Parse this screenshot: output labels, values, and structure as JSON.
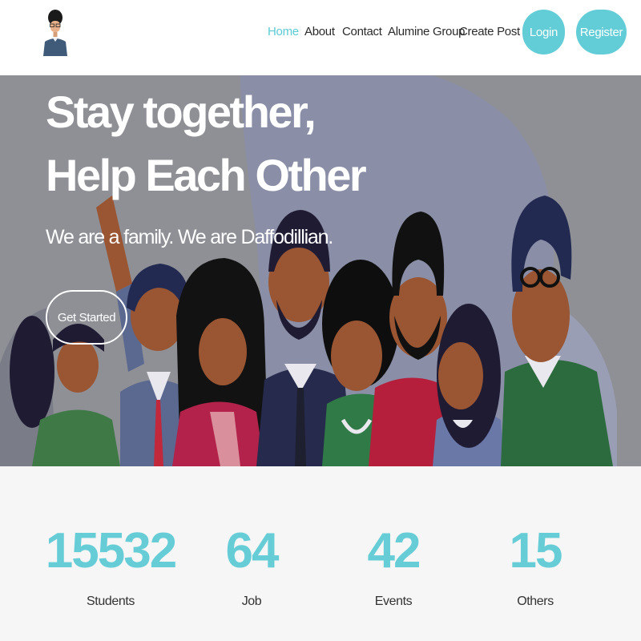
{
  "nav": {
    "home": "Home",
    "about": "About",
    "contact": "Contact",
    "alumine_group": "Alumine Group",
    "create_post": "Create Post",
    "login": "Login",
    "register": "Register",
    "dropdown_icon": "chevron-down-icon"
  },
  "hero": {
    "title_line1": "Stay together,",
    "title_line2": "Help Each Other",
    "subtitle": "We are a family. We are Daffodillian.",
    "cta": "Get Started"
  },
  "stats": [
    {
      "value": "15532",
      "label": "Students"
    },
    {
      "value": "64",
      "label": "Job"
    },
    {
      "value": "42",
      "label": "Events"
    },
    {
      "value": "15",
      "label": "Others"
    }
  ],
  "colors": {
    "accent": "#5ccbd6",
    "hero_bg": "#8c8e92",
    "stats_bg": "#f6f6f6"
  }
}
